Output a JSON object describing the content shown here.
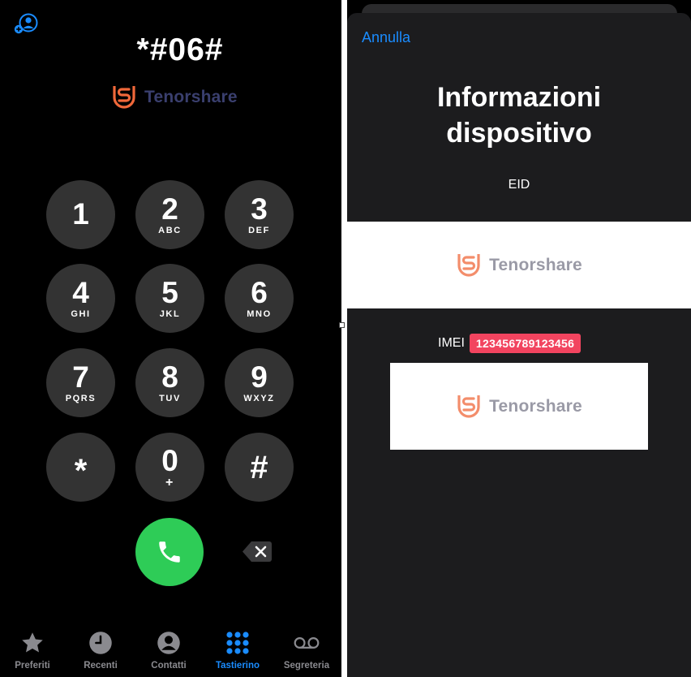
{
  "dialer": {
    "dialed_number": "*#06#",
    "watermark": "Tenorshare",
    "keys": [
      {
        "digit": "1",
        "letters": ""
      },
      {
        "digit": "2",
        "letters": "ABC"
      },
      {
        "digit": "3",
        "letters": "DEF"
      },
      {
        "digit": "4",
        "letters": "GHI"
      },
      {
        "digit": "5",
        "letters": "JKL"
      },
      {
        "digit": "6",
        "letters": "MNO"
      },
      {
        "digit": "7",
        "letters": "PQRS"
      },
      {
        "digit": "8",
        "letters": "TUV"
      },
      {
        "digit": "9",
        "letters": "WXYZ"
      },
      {
        "digit": "*",
        "letters": ""
      },
      {
        "digit": "0",
        "letters": "+"
      },
      {
        "digit": "#",
        "letters": ""
      }
    ]
  },
  "tabbar": {
    "tabs": [
      {
        "label": "Preferiti",
        "icon": "star-icon"
      },
      {
        "label": "Recenti",
        "icon": "clock-icon"
      },
      {
        "label": "Contatti",
        "icon": "person-circle-icon"
      },
      {
        "label": "Tastierino",
        "icon": "keypad-icon"
      },
      {
        "label": "Segreteria",
        "icon": "voicemail-icon"
      }
    ],
    "active_tab": "Tastierino"
  },
  "sheet": {
    "cancel_label": "Annulla",
    "title_line1": "Informazioni",
    "title_line2": "dispositivo",
    "eid_label": "EID",
    "imei_label": "IMEI",
    "imei_value": "123456789123456",
    "watermark": "Tenorshare"
  },
  "colors": {
    "accent": "#1a8cff",
    "call_green": "#2ecc57",
    "badge_red": "#f2445f",
    "logo_orange": "#f0683a",
    "key_gray": "#333333"
  }
}
